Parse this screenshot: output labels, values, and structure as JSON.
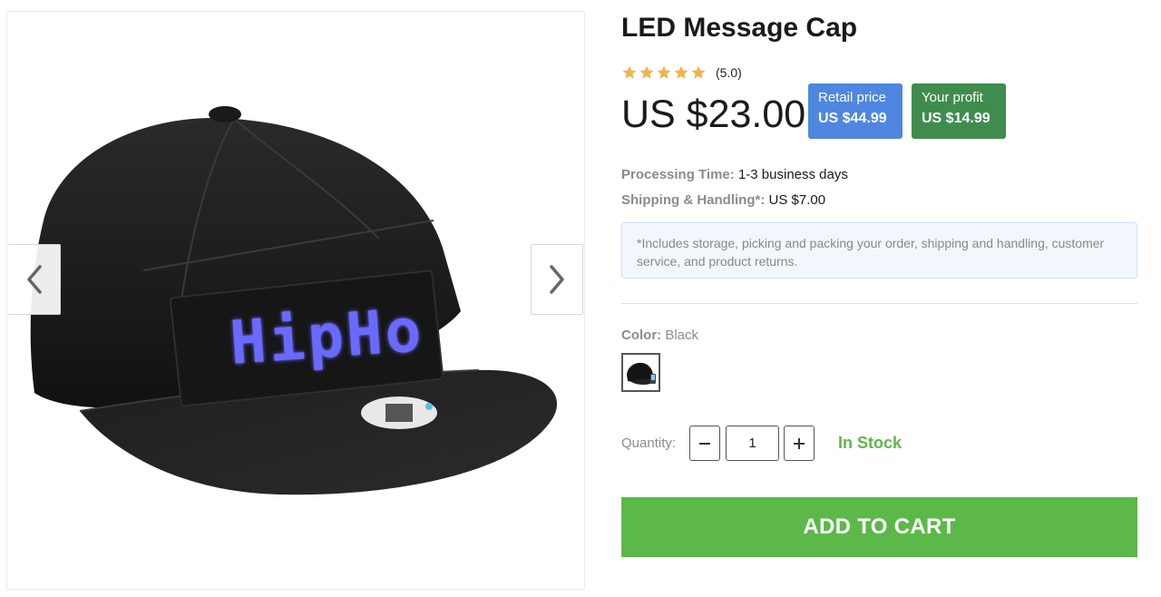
{
  "product": {
    "title": "LED Message Cap",
    "rating_text": "(5.0)",
    "star_count": 5,
    "price": "US $23.00",
    "led_text": "HipHo"
  },
  "badges": {
    "retail": {
      "label": "Retail price",
      "value": "US $44.99",
      "color": "#4f86e0"
    },
    "profit": {
      "label": "Your profit",
      "value": "US $14.99",
      "color": "#3f8c4e"
    }
  },
  "details": {
    "processing_label": "Processing Time:",
    "processing_value": "1-3 business days",
    "shipping_label": "Shipping & Handling*:",
    "shipping_value": "US $7.00",
    "note": "*Includes storage, picking and packing your order, shipping and handling, customer service, and product returns."
  },
  "color": {
    "label": "Color:",
    "value": "Black"
  },
  "quantity": {
    "label": "Quantity:",
    "value": "1",
    "minus_icon": "minus-icon",
    "plus_icon": "plus-icon"
  },
  "stock": {
    "text": "In Stock",
    "color": "#5cb848"
  },
  "cart": {
    "label": "ADD TO CART",
    "color": "#5cb848"
  },
  "gallery": {
    "prev_icon": "chevron-left-icon",
    "next_icon": "chevron-right-icon"
  },
  "colors": {
    "star": "#f0b44c",
    "text_muted": "#8c8c8c"
  }
}
